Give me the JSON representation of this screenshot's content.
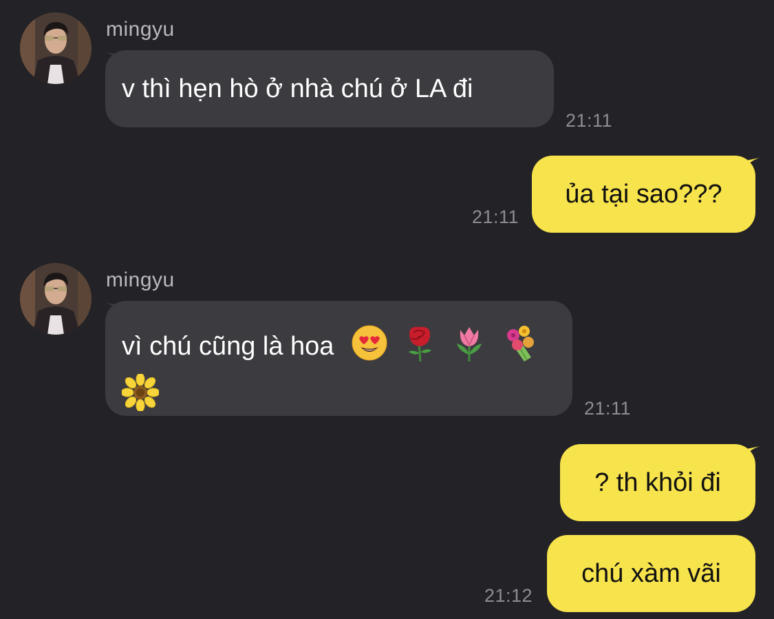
{
  "chat": {
    "messages": [
      {
        "direction": "incoming",
        "sender": "mingyu",
        "avatar_icon": "profile-photo",
        "text": "v thì hẹn hò ở nhà chú ở LA đi",
        "time": "21:11"
      },
      {
        "direction": "outgoing",
        "text": "ủa tại sao???",
        "time": "21:11"
      },
      {
        "direction": "incoming",
        "sender": "mingyu",
        "avatar_icon": "profile-photo",
        "text": "vì chú cũng là hoa",
        "emoji": [
          "smiling-face-with-heart-eyes",
          "rose",
          "tulip",
          "bouquet",
          "sunflower"
        ],
        "time": "21:11"
      },
      {
        "direction": "outgoing",
        "text": "? th khỏi đi",
        "time": ""
      },
      {
        "direction": "outgoing",
        "text": "chú xàm vãi",
        "time": "21:12"
      }
    ]
  },
  "colors": {
    "background": "#232226",
    "incoming_bubble": "#3c3b40",
    "outgoing_bubble": "#f7e34c",
    "timestamp": "#8e8d93",
    "sender_name": "#b9b9bf"
  }
}
